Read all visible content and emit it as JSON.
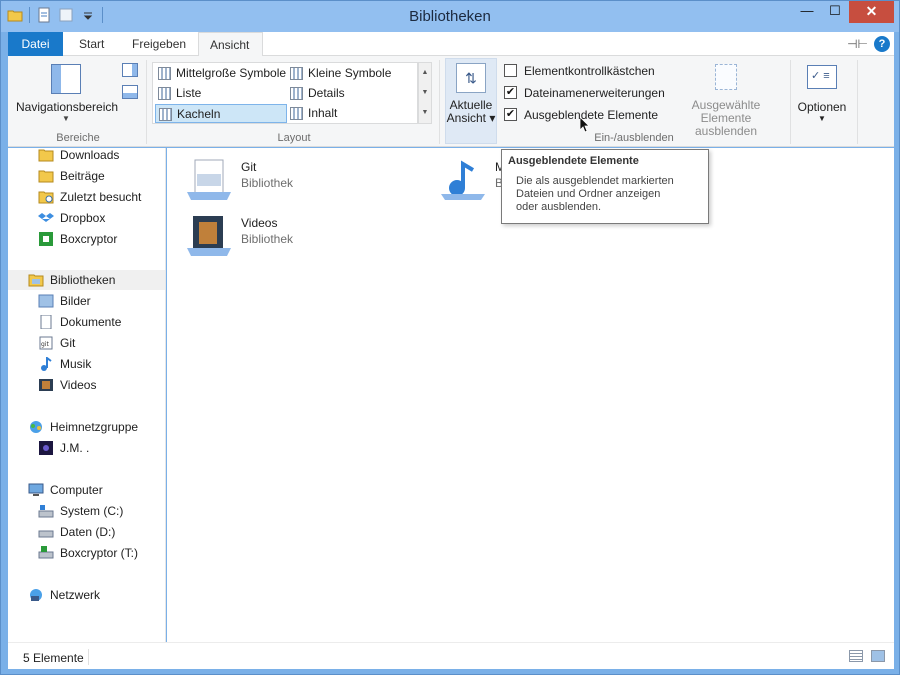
{
  "window": {
    "title": "Bibliotheken"
  },
  "tabs": {
    "file": "Datei",
    "start": "Start",
    "share": "Freigeben",
    "view": "Ansicht"
  },
  "ribbon": {
    "groups": {
      "panes": "Bereiche",
      "layout": "Layout",
      "showhide": "Ein-/ausblenden"
    },
    "nav_pane_label": "Navigationsbereich",
    "layout_items": [
      "Mittelgroße Symbole",
      "Kleine Symbole",
      "Liste",
      "Details",
      "Kacheln",
      "Inhalt"
    ],
    "layout_selected": "Kacheln",
    "current_view_line1": "Aktuelle",
    "current_view_line2": "Ansicht",
    "checkboxes": [
      {
        "label": "Elementkontrollkästchen",
        "checked": false
      },
      {
        "label": "Dateinamenerweiterungen",
        "checked": true
      },
      {
        "label": "Ausgeblendete Elemente",
        "checked": true
      }
    ],
    "hide_selected_line1": "Ausgewählte",
    "hide_selected_line2": "Elemente ausblenden",
    "options_label": "Optionen"
  },
  "nav_pane": {
    "favorites": [
      "Downloads",
      "Beiträge",
      "Zuletzt besucht",
      "Dropbox",
      "Boxcryptor"
    ],
    "libraries": "Bibliotheken",
    "library_items": [
      "Bilder",
      "Dokumente",
      "Git",
      "Musik",
      "Videos"
    ],
    "homegroup": "Heimnetzgruppe",
    "homegroup_items": [
      "J.M. ."
    ],
    "computer": "Computer",
    "computer_items": [
      "System (C:)",
      "Daten (D:)",
      "Boxcryptor (T:)"
    ],
    "network": "Netzwerk"
  },
  "content": {
    "tiles": [
      {
        "name": "Git",
        "type": "Bibliothek",
        "icon": "git-library-icon"
      },
      {
        "name": "Musik",
        "type": "Bibliothek",
        "icon": "music-library-icon"
      },
      {
        "name": "Videos",
        "type": "Bibliothek",
        "icon": "video-library-icon"
      }
    ]
  },
  "tooltip": {
    "title": "Ausgeblendete Elemente",
    "text_line1": "Die als ausgeblendet markierten",
    "text_line2": "Dateien und Ordner anzeigen",
    "text_line3": "oder ausblenden."
  },
  "status": {
    "count": "5 Elemente"
  },
  "colors": {
    "accent": "#1979ca",
    "frame": "#92bff0",
    "close": "#c74e3f",
    "selection": "#cde6f7"
  }
}
